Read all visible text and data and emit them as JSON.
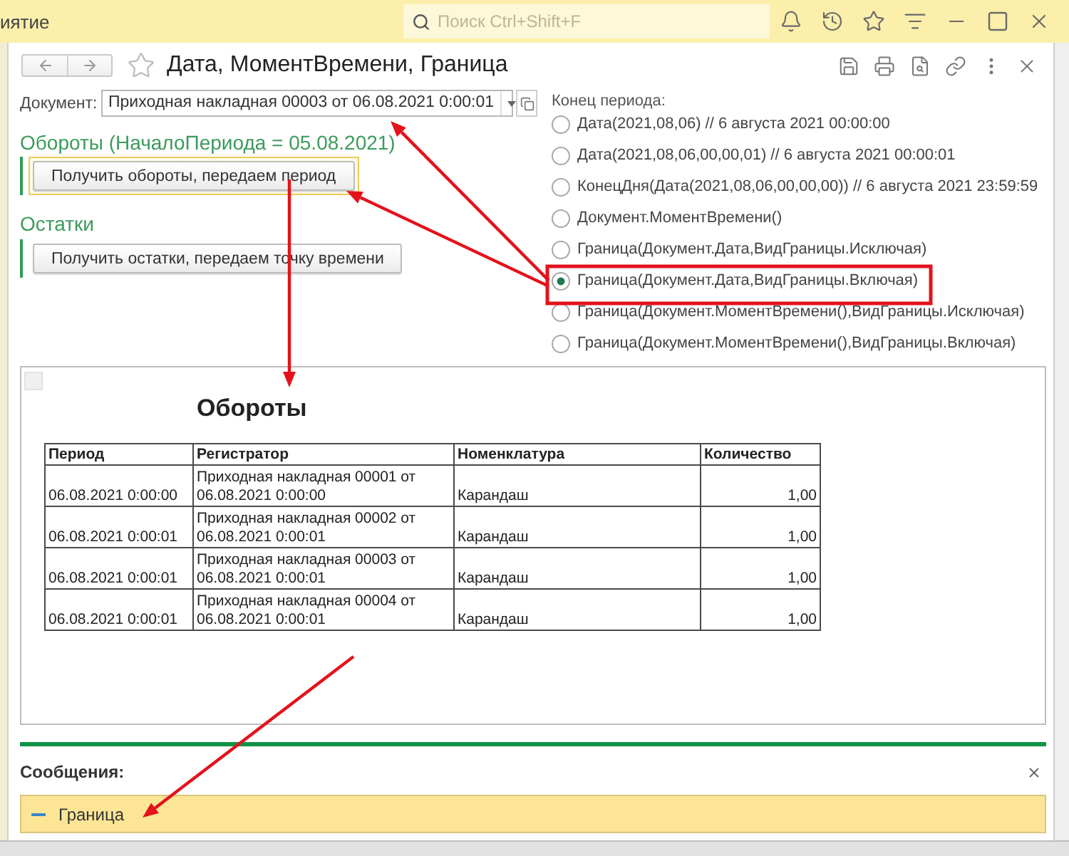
{
  "app_bar": {
    "title": "иятие",
    "search": {
      "placeholder": "Поиск Ctrl+Shift+F"
    }
  },
  "form": {
    "title": "Дата, МоментВремени, Граница",
    "document": {
      "label": "Документ:",
      "value": "Приходная накладная 00003 от 06.08.2021 0:00:01"
    },
    "groups": [
      {
        "title": "Обороты (НачалоПериода = 05.08.2021)",
        "button": "Получить обороты, передаем период",
        "focused": true
      },
      {
        "title": "Остатки",
        "button": "Получить остатки, передаем точку времени",
        "focused": false
      }
    ],
    "period_end": {
      "label": "Конец периода:",
      "options": [
        {
          "label": "Дата(2021,08,06) // 6 августа 2021 00:00:00",
          "selected": false
        },
        {
          "label": "Дата(2021,08,06,00,00,01) // 6 августа 2021 00:00:01",
          "selected": false
        },
        {
          "label": "КонецДня(Дата(2021,08,06,00,00,00)) // 6 августа 2021 23:59:59",
          "selected": false
        },
        {
          "label": "Документ.МоментВремени()",
          "selected": false
        },
        {
          "label": "Граница(Документ.Дата,ВидГраницы.Исключая)",
          "selected": false
        },
        {
          "label": "Граница(Документ.Дата,ВидГраницы.Включая)",
          "selected": true
        },
        {
          "label": "Граница(Документ.МоментВремени(),ВидГраницы.Исключая)",
          "selected": false
        },
        {
          "label": "Граница(Документ.МоментВремени(),ВидГраницы.Включая)",
          "selected": false
        }
      ]
    },
    "report": {
      "title": "Обороты",
      "columns": [
        "Период",
        "Регистратор",
        "Номенклатура",
        "Количество"
      ],
      "rows": [
        {
          "period": "06.08.2021 0:00:00",
          "registrar": "Приходная накладная 00001 от 06.08.2021 0:00:00",
          "item": "Карандаш",
          "quantity": "1,00"
        },
        {
          "period": "06.08.2021 0:00:01",
          "registrar": "Приходная накладная 00002 от 06.08.2021 0:00:01",
          "item": "Карандаш",
          "quantity": "1,00"
        },
        {
          "period": "06.08.2021 0:00:01",
          "registrar": "Приходная накладная 00003 от 06.08.2021 0:00:01",
          "item": "Карандаш",
          "quantity": "1,00"
        },
        {
          "period": "06.08.2021 0:00:01",
          "registrar": "Приходная накладная 00004 от 06.08.2021 0:00:01",
          "item": "Карандаш",
          "quantity": "1,00"
        }
      ]
    },
    "messages": {
      "title": "Сообщения:",
      "items": [
        {
          "text": "Граница"
        }
      ]
    }
  }
}
